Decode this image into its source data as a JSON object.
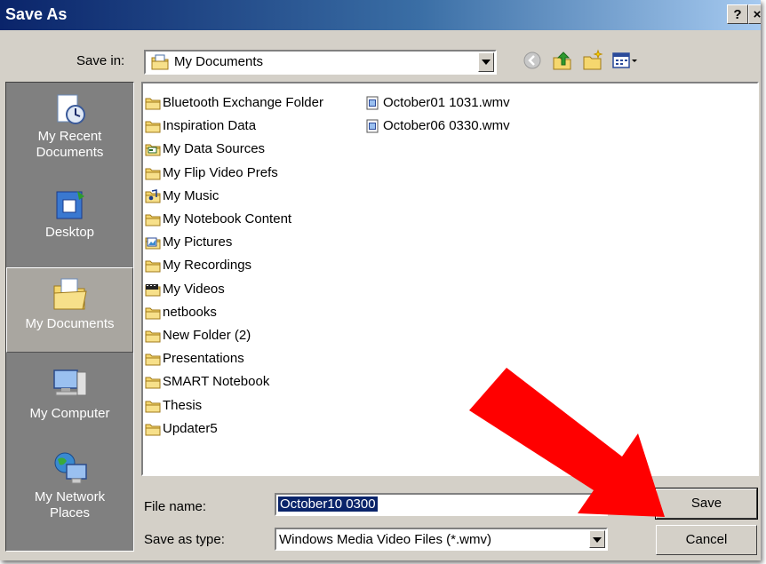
{
  "title": "Save As",
  "title_buttons": {
    "help": "?",
    "close": "×"
  },
  "save_in": {
    "label": "Save in:",
    "value": "My Documents"
  },
  "places": [
    {
      "label": "My Recent Documents",
      "icon": "recent-documents-icon"
    },
    {
      "label": "Desktop",
      "icon": "desktop-icon"
    },
    {
      "label": "My Documents",
      "icon": "my-documents-icon",
      "selected": true
    },
    {
      "label": "My Computer",
      "icon": "my-computer-icon"
    },
    {
      "label": "My Network Places",
      "icon": "network-places-icon"
    }
  ],
  "files_col1": [
    {
      "name": "Bluetooth Exchange Folder",
      "icon": "folder"
    },
    {
      "name": "Inspiration Data",
      "icon": "folder"
    },
    {
      "name": "My Data Sources",
      "icon": "data-sources-folder"
    },
    {
      "name": "My Flip Video Prefs",
      "icon": "folder"
    },
    {
      "name": "My Music",
      "icon": "music-folder"
    },
    {
      "name": "My Notebook Content",
      "icon": "folder"
    },
    {
      "name": "My Pictures",
      "icon": "pictures-folder"
    },
    {
      "name": "My Recordings",
      "icon": "folder"
    },
    {
      "name": "My Videos",
      "icon": "videos-folder"
    },
    {
      "name": "netbooks",
      "icon": "folder"
    },
    {
      "name": "New Folder (2)",
      "icon": "folder"
    },
    {
      "name": "Presentations",
      "icon": "folder"
    },
    {
      "name": "SMART Notebook",
      "icon": "folder"
    },
    {
      "name": "Thesis",
      "icon": "folder"
    },
    {
      "name": "Updater5",
      "icon": "folder"
    }
  ],
  "files_col2": [
    {
      "name": "October01 1031.wmv",
      "icon": "wmv-file"
    },
    {
      "name": "October06 0330.wmv",
      "icon": "wmv-file"
    }
  ],
  "file_name": {
    "label": "File name:",
    "value": "October10 0300"
  },
  "save_type": {
    "label": "Save as type:",
    "value": "Windows Media Video Files (*.wmv)"
  },
  "buttons": {
    "save": "Save",
    "cancel": "Cancel"
  },
  "colors": {
    "title_bar": "#0a246a",
    "dialog": "#d4d0c8",
    "arrow": "#ff0000",
    "folder": "#f5d76e"
  }
}
